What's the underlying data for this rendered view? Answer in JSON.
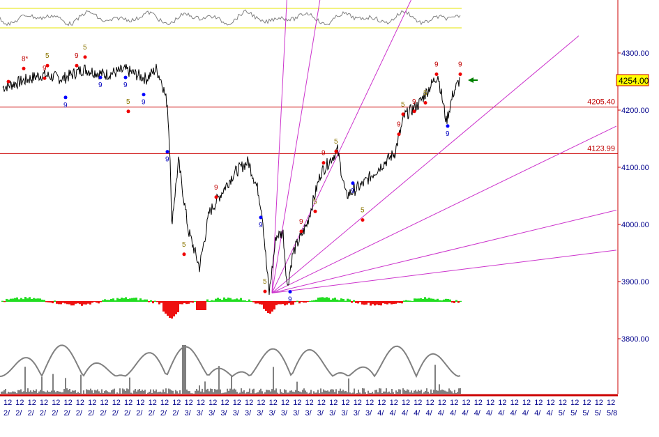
{
  "chart_data": {
    "type": "line",
    "title": "",
    "ylim": [
      3700,
      4400
    ],
    "y_ticks": [
      "4300.00",
      "4200.00",
      "4100.00",
      "4000.00",
      "3900.00",
      "3800.00"
    ],
    "y_tick_values": [
      4300,
      4200,
      4100,
      4000,
      3900,
      3800
    ],
    "last_price": "4254.00",
    "levels": [
      {
        "label": "4205.40",
        "value": 4205.4
      },
      {
        "label": "4123.99",
        "value": 4123.99
      }
    ],
    "x_range": [
      0,
      440
    ],
    "price_series": [
      [
        2,
        4240
      ],
      [
        15,
        4250
      ],
      [
        30,
        4262
      ],
      [
        45,
        4255
      ],
      [
        60,
        4272
      ],
      [
        75,
        4262
      ],
      [
        90,
        4270
      ],
      [
        105,
        4255
      ],
      [
        112,
        4272
      ],
      [
        116,
        4250
      ],
      [
        120,
        4210
      ],
      [
        122,
        4120
      ],
      [
        123,
        4000
      ],
      [
        128,
        4110
      ],
      [
        135,
        3990
      ],
      [
        143,
        3925
      ],
      [
        150,
        4020
      ],
      [
        160,
        4060
      ],
      [
        168,
        4090
      ],
      [
        178,
        4110
      ],
      [
        185,
        4060
      ],
      [
        188,
        4020
      ],
      [
        191,
        3930
      ],
      [
        193,
        3880
      ],
      [
        198,
        3980
      ],
      [
        203,
        3985
      ],
      [
        206,
        3890
      ],
      [
        210,
        3950
      ],
      [
        220,
        4000
      ],
      [
        230,
        4090
      ],
      [
        242,
        4130
      ],
      [
        248,
        4050
      ],
      [
        260,
        4070
      ],
      [
        272,
        4100
      ],
      [
        283,
        4125
      ],
      [
        290,
        4190
      ],
      [
        300,
        4210
      ],
      [
        314,
        4262
      ],
      [
        320,
        4180
      ],
      [
        325,
        4230
      ],
      [
        330,
        4255
      ]
    ],
    "fan_origin": [
      195,
      3880
    ],
    "fan_end_prices_at_right": [
      4940,
      4700,
      4430,
      4330,
      4172,
      4025,
      3955
    ],
    "fan_end_x": [
      217,
      250,
      302,
      415,
      442,
      442,
      442
    ],
    "markers": [
      {
        "x": 6,
        "p": 4262,
        "t": "●",
        "c": "#e00000"
      },
      {
        "x": 17,
        "p": 4285,
        "t": "8*",
        "c": "#c00000"
      },
      {
        "x": 34,
        "p": 4290,
        "t": "5",
        "c": "#8b7500"
      },
      {
        "x": 32,
        "p": 4268,
        "t": "9",
        "c": "#c00000"
      },
      {
        "x": 55,
        "p": 4290,
        "t": "9",
        "c": "#c00000"
      },
      {
        "x": 61,
        "p": 4305,
        "t": "5",
        "c": "#8b7500"
      },
      {
        "x": 72,
        "p": 4245,
        "t": "9",
        "c": "#0000c0"
      },
      {
        "x": 90,
        "p": 4245,
        "t": "9",
        "c": "#0000c0"
      },
      {
        "x": 47,
        "p": 4210,
        "t": "9",
        "c": "#0000c0"
      },
      {
        "x": 92,
        "p": 4210,
        "t": "5",
        "c": "#8b7500"
      },
      {
        "x": 103,
        "p": 4215,
        "t": "9",
        "c": "#0000c0"
      },
      {
        "x": 120,
        "p": 4115,
        "t": "9",
        "c": "#0000c0"
      },
      {
        "x": 155,
        "p": 4060,
        "t": "9",
        "c": "#c00000"
      },
      {
        "x": 132,
        "p": 3960,
        "t": "5",
        "c": "#8b7500"
      },
      {
        "x": 187,
        "p": 4000,
        "t": "9",
        "c": "#0000c0"
      },
      {
        "x": 190,
        "p": 3895,
        "t": "5",
        "c": "#8b7500"
      },
      {
        "x": 208,
        "p": 3870,
        "t": "9",
        "c": "#0000c0"
      },
      {
        "x": 216,
        "p": 4000,
        "t": "9",
        "c": "#c00000"
      },
      {
        "x": 226,
        "p": 4035,
        "t": "5",
        "c": "#8b7500"
      },
      {
        "x": 232,
        "p": 4120,
        "t": "9",
        "c": "#c00000"
      },
      {
        "x": 241,
        "p": 4140,
        "t": "5",
        "c": "#8b7500"
      },
      {
        "x": 253,
        "p": 4060,
        "t": "9",
        "c": "#0000c0"
      },
      {
        "x": 260,
        "p": 4020,
        "t": "5",
        "c": "#8b7500"
      },
      {
        "x": 286,
        "p": 4170,
        "t": "9",
        "c": "#c00000"
      },
      {
        "x": 289,
        "p": 4205,
        "t": "5",
        "c": "#8b7500"
      },
      {
        "x": 297,
        "p": 4210,
        "t": "9",
        "c": "#c00000"
      },
      {
        "x": 305,
        "p": 4225,
        "t": "5",
        "c": "#8b7500"
      },
      {
        "x": 313,
        "p": 4275,
        "t": "9",
        "c": "#c00000"
      },
      {
        "x": 321,
        "p": 4160,
        "t": "9",
        "c": "#0000c0"
      },
      {
        "x": 330,
        "p": 4275,
        "t": "9",
        "c": "#c00000"
      }
    ],
    "x_ticks_top": "12",
    "x_ticks_bottom": [
      "2/",
      "2/",
      "2/",
      "2/",
      "2/",
      "2/",
      "2/",
      "2/",
      "2/",
      "2/",
      "2/",
      "2/",
      "2/",
      "2/",
      "2/",
      "3/",
      "3/",
      "3/",
      "3/",
      "3/",
      "3/",
      "3/",
      "3/",
      "3/",
      "3/",
      "3/",
      "3/",
      "3/",
      "3/",
      "3/",
      "3/",
      "4/",
      "4/",
      "4/",
      "4/",
      "4/",
      "4/",
      "4/",
      "4/",
      "4/",
      "4/",
      "4/",
      "4/",
      "4/",
      "4/",
      "4/",
      "5/",
      "5/",
      "5/",
      "5/",
      "5/8"
    ]
  },
  "colors": {
    "price": "#000000",
    "level": "#cc0000",
    "fan": "#cc33cc",
    "axis": "#cc0000",
    "osc": "#808080",
    "oscband": "#e6e600",
    "up": "#22dd22",
    "down": "#ee1111",
    "label": "#00008b"
  }
}
